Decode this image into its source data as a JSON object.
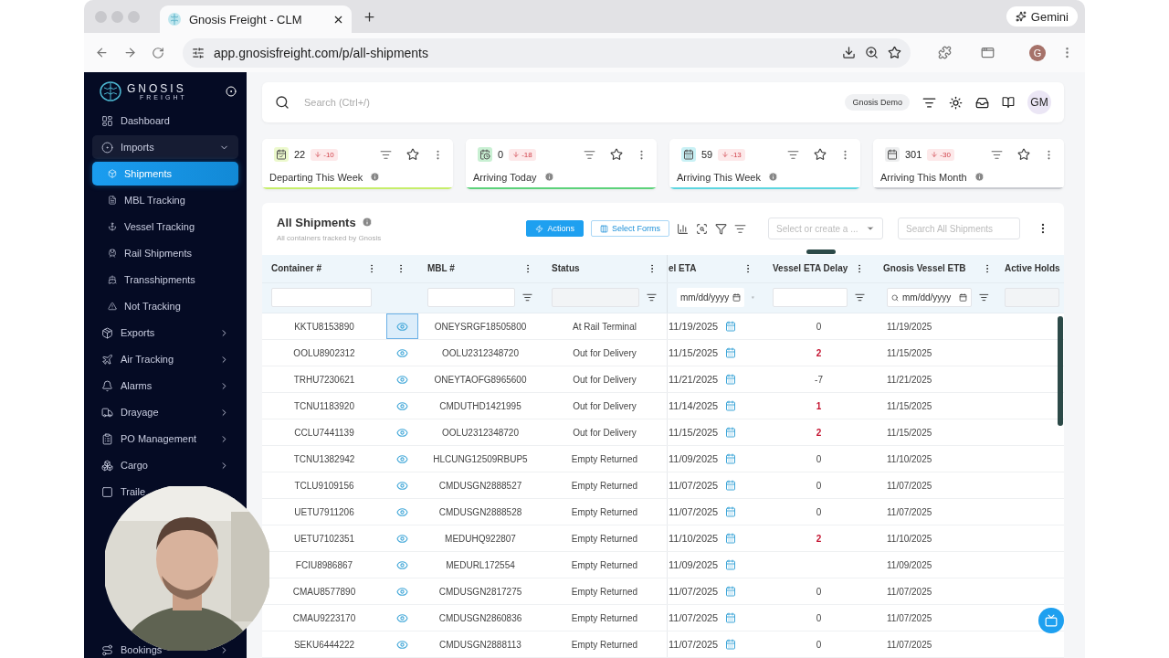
{
  "browser": {
    "tab_title": "Gnosis Freight - CLM",
    "assistant": "Gemini",
    "url": "app.gnosisfreight.com/p/all-shipments",
    "profile_initial": "G"
  },
  "sidebar": {
    "brand": "GNOSIS",
    "brand_sub": "FREIGHT",
    "items": [
      {
        "label": "Dashboard",
        "selected": false
      },
      {
        "label": "Imports",
        "selected": false,
        "expanded": true,
        "children": [
          {
            "label": "Shipments",
            "selected": true
          },
          {
            "label": "MBL Tracking",
            "selected": false
          },
          {
            "label": "Vessel Tracking",
            "selected": false
          },
          {
            "label": "Rail Shipments",
            "selected": false
          },
          {
            "label": "Transshipments",
            "selected": false
          },
          {
            "label": "Not Tracking",
            "selected": false
          }
        ]
      },
      {
        "label": "Exports",
        "selected": false,
        "expanded": false
      },
      {
        "label": "Air Tracking",
        "selected": false,
        "expanded": false
      },
      {
        "label": "Alarms",
        "selected": false,
        "expanded": false
      },
      {
        "label": "Drayage",
        "selected": false,
        "expanded": false
      },
      {
        "label": "PO Management",
        "selected": false,
        "expanded": false
      },
      {
        "label": "Cargo",
        "selected": false,
        "expanded": false
      },
      {
        "label": "Traile",
        "selected": false
      }
    ],
    "footer_items": [
      {
        "label": "Bookings",
        "selected": false,
        "expanded": false
      }
    ]
  },
  "topbar": {
    "search_placeholder": "Search (Ctrl+/)",
    "workspace": "Gnosis Demo",
    "avatar": "GM"
  },
  "kpis": [
    {
      "count": "22",
      "change": "-10",
      "label": "Departing This Week",
      "color": "#c6ee6a"
    },
    {
      "count": "0",
      "change": "-18",
      "label": "Arriving Today",
      "color": "#5cd27a"
    },
    {
      "count": "59",
      "change": "-13",
      "label": "Arriving This Week",
      "color": "#5dd6e0"
    },
    {
      "count": "301",
      "change": "-30",
      "label": "Arriving This Month",
      "color": "#c9cbd0"
    }
  ],
  "table": {
    "title": "All Shipments",
    "subtitle": "All containers tracked by Gnosis",
    "actions": "Actions",
    "select_forms": "Select Forms",
    "view_placeholder": "Select or create a ...",
    "search_placeholder": "Search All Shipments",
    "columns": [
      "Container #",
      "MBL #",
      "Status",
      "el ETA",
      "Vessel ETA Delay",
      "Gnosis Vessel ETB",
      "Active Holds"
    ],
    "filters": {
      "eta": "mm/dd/yyyy",
      "etb": "mm/dd/yyyy"
    },
    "rows": [
      {
        "container": "KKTU8153890",
        "mbl": "ONEYSRGF18505800",
        "status": "At Rail Terminal",
        "eta": "11/19/2025",
        "delay": "0",
        "delayed": false,
        "etb": "11/19/2025",
        "focused": true
      },
      {
        "container": "OOLU8902312",
        "mbl": "OOLU2312348720",
        "status": "Out for Delivery",
        "eta": "11/15/2025",
        "delay": "2",
        "delayed": true,
        "etb": "11/15/2025",
        "focused": false
      },
      {
        "container": "TRHU7230621",
        "mbl": "ONEYTAOFG8965600",
        "status": "Out for Delivery",
        "eta": "11/21/2025",
        "delay": "-7",
        "delayed": false,
        "etb": "11/21/2025",
        "focused": false
      },
      {
        "container": "TCNU1183920",
        "mbl": "CMDUTHD1421995",
        "status": "Out for Delivery",
        "eta": "11/14/2025",
        "delay": "1",
        "delayed": true,
        "etb": "11/15/2025",
        "focused": false
      },
      {
        "container": "CCLU7441139",
        "mbl": "OOLU2312348720",
        "status": "Out for Delivery",
        "eta": "11/15/2025",
        "delay": "2",
        "delayed": true,
        "etb": "11/15/2025",
        "focused": false
      },
      {
        "container": "TCNU1382942",
        "mbl": "HLCUNG12509RBUP5",
        "status": "Empty Returned",
        "eta": "11/09/2025",
        "delay": "0",
        "delayed": false,
        "etb": "11/10/2025",
        "focused": false
      },
      {
        "container": "TCLU9109156",
        "mbl": "CMDUSGN2888527",
        "status": "Empty Returned",
        "eta": "11/07/2025",
        "delay": "0",
        "delayed": false,
        "etb": "11/07/2025",
        "focused": false
      },
      {
        "container": "UETU7911206",
        "mbl": "CMDUSGN2888528",
        "status": "Empty Returned",
        "eta": "11/07/2025",
        "delay": "0",
        "delayed": false,
        "etb": "11/07/2025",
        "focused": false
      },
      {
        "container": "UETU7102351",
        "mbl": "MEDUHQ922807",
        "status": "Empty Returned",
        "eta": "11/10/2025",
        "delay": "2",
        "delayed": true,
        "etb": "11/10/2025",
        "focused": false
      },
      {
        "container": "FCIU8986867",
        "mbl": "MEDURL172554",
        "status": "Empty Returned",
        "eta": "11/09/2025",
        "etb": "11/09/2025",
        "focused": false
      },
      {
        "container": "CMAU8577890",
        "mbl": "CMDUSGN2817275",
        "status": "Empty Returned",
        "eta": "11/07/2025",
        "delay": "0",
        "delayed": false,
        "etb": "11/07/2025",
        "focused": false
      },
      {
        "container": "CMAU9223170",
        "mbl": "CMDUSGN2860836",
        "status": "Empty Returned",
        "eta": "11/07/2025",
        "delay": "0",
        "delayed": false,
        "etb": "11/07/2025",
        "focused": false
      },
      {
        "container": "SEKU6444222",
        "mbl": "CMDUSGN2888113",
        "status": "Empty Returned",
        "eta": "11/07/2025",
        "delay": "0",
        "delayed": false,
        "etb": "11/07/2025",
        "focused": false
      }
    ]
  }
}
